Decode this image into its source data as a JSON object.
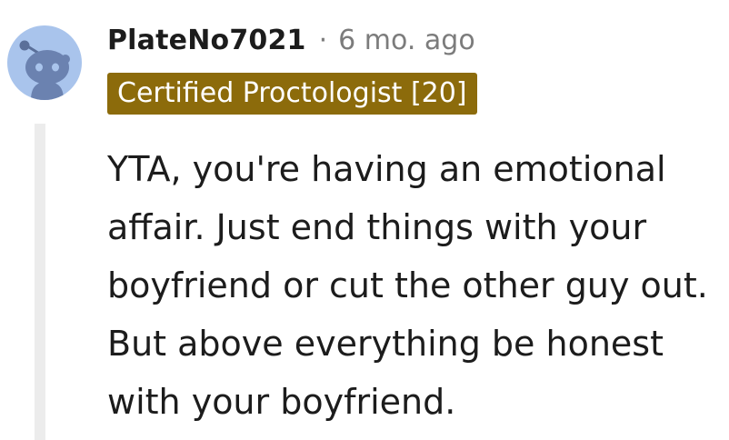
{
  "comment": {
    "username": "PlateNo7021",
    "separator": "·",
    "timestamp": "6 mo. ago",
    "flair": "Certified Proctologist [20]",
    "body": "YTA, you're having an emotional affair. Just end things with your boyfriend or cut the other guy out. But above everything be honest with your boyfriend."
  },
  "colors": {
    "avatar_bg": "#a9c4ec",
    "flair_bg": "#8c6b0b",
    "thread_line": "#ececec",
    "muted_text": "#7c7c7c",
    "text": "#1c1c1c"
  },
  "icons": {
    "avatar": "reddit-snoo-avatar-icon"
  }
}
